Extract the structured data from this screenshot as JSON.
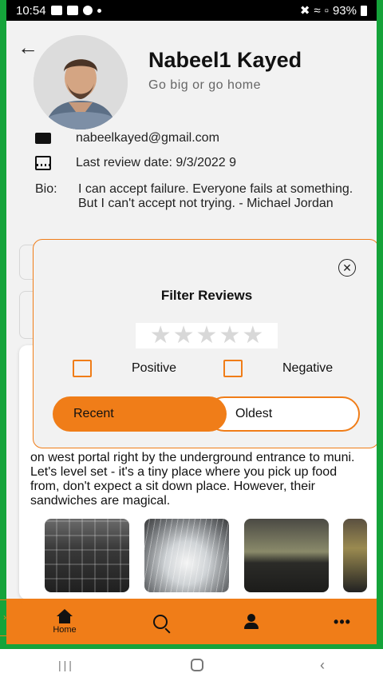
{
  "status_bar": {
    "time": "10:54",
    "battery": "93%"
  },
  "profile": {
    "name": "Nabeel1 Kayed",
    "motto": "Go big or go home",
    "email": "nabeelkayed@gmail.com",
    "last_review": "Last review date: 9/3/2022 9",
    "bio_label": "Bio:",
    "bio_text": "I can accept failure. Everyone fails at something. But I can't accept not trying. - Michael Jordan"
  },
  "review": {
    "text": "on west portal right by the underground entrance to muni. Let's level set - it's a tiny place where you pick up food from, don't expect a sit down place. However, their sandwiches are magical."
  },
  "filter_modal": {
    "title": "Filter Reviews",
    "rating_stars": 5,
    "positive_label": "Positive",
    "negative_label": "Negative",
    "positive_checked": false,
    "negative_checked": false,
    "recent_label": "Recent",
    "oldest_label": "Oldest",
    "selected_sort": "Recent"
  },
  "bottom_nav": {
    "home_label": "Home"
  },
  "colors": {
    "accent": "#f07d18",
    "frame": "#15a33a",
    "background": "#f2f2f2"
  }
}
